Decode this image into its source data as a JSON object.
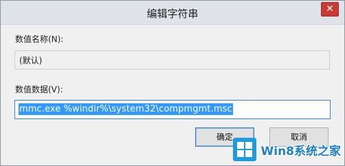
{
  "window": {
    "title": "编辑字符串",
    "close_label": "✕"
  },
  "value_name": {
    "label": "数值名称(N):",
    "value": "(默认)"
  },
  "value_data": {
    "label": "数值数据(V):",
    "value": "mmc.exe %windir%\\system32\\compmgmt.msc"
  },
  "buttons": {
    "ok": "确定",
    "cancel": "取消"
  },
  "watermark": {
    "text": "Win8系统之家"
  },
  "colors": {
    "selection": "#3399ff",
    "focus_border": "#3c80c8",
    "close_button": "#c83a35"
  }
}
